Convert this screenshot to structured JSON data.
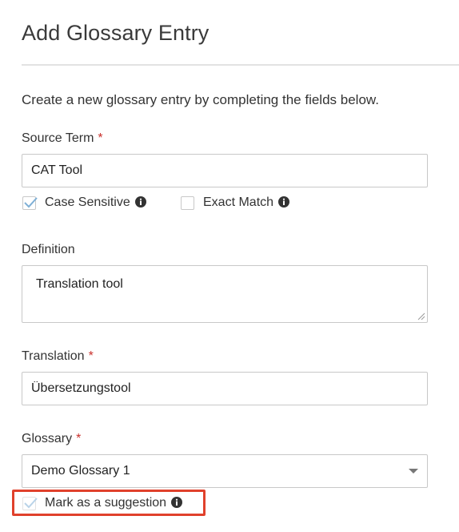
{
  "form": {
    "title": "Add Glossary Entry",
    "intro": "Create a new glossary entry by completing the fields below.",
    "required_mark": "*",
    "source_term": {
      "label": "Source Term",
      "value": "CAT Tool",
      "case_sensitive": {
        "label": "Case Sensitive",
        "checked": true
      },
      "exact_match": {
        "label": "Exact Match",
        "checked": false
      }
    },
    "definition": {
      "label": "Definition",
      "value": "Translation tool"
    },
    "translation": {
      "label": "Translation",
      "value": "Übersetzungstool"
    },
    "glossary": {
      "label": "Glossary",
      "selected": "Demo Glossary 1"
    },
    "suggestion": {
      "label": "Mark as a suggestion",
      "checked": true
    }
  },
  "colors": {
    "required": "#c9302c",
    "check": "#7fb0d6",
    "highlight": "#e0412c"
  },
  "icons": {
    "info": "info-circle-icon",
    "check": "check-icon",
    "caret": "caret-down-icon",
    "resize": "resize-grip-icon"
  }
}
